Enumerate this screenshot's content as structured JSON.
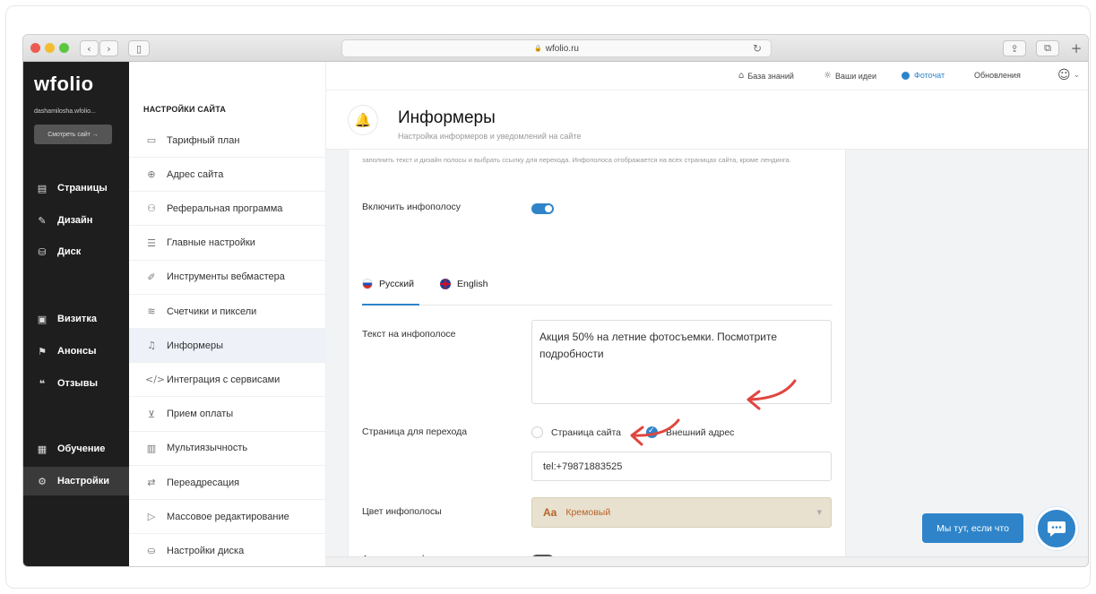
{
  "browser": {
    "url": "wfolio.ru",
    "back_glyph": "‹",
    "forward_glyph": "›",
    "sidebar_glyph": "▯",
    "share_glyph": "⇪",
    "tabs_glyph": "⧉",
    "newtab_glyph": "+",
    "reload_glyph": "↻",
    "lock_glyph": "🔒"
  },
  "leftnav": {
    "logo": "wfolio",
    "user": "dashamilosha.wfolio...",
    "view_site": "Смотреть сайт →",
    "items": [
      {
        "label": "Страницы",
        "icon": "page-icon",
        "glyph": "▤"
      },
      {
        "label": "Дизайн",
        "icon": "brush-icon",
        "glyph": "✎"
      },
      {
        "label": "Диск",
        "icon": "disk-icon",
        "glyph": "⛁"
      },
      {
        "label": "Визитка",
        "icon": "card-icon",
        "glyph": "▣"
      },
      {
        "label": "Анонсы",
        "icon": "megaphone-icon",
        "glyph": "⚑"
      },
      {
        "label": "Отзывы",
        "icon": "comments-icon",
        "glyph": "❝"
      },
      {
        "label": "Обучение",
        "icon": "book-icon",
        "glyph": "▦"
      },
      {
        "label": "Настройки",
        "icon": "gear-icon",
        "glyph": "⚙"
      }
    ]
  },
  "settings": {
    "title": "НАСТРОЙКИ САЙТА",
    "items": [
      {
        "label": "Тарифный план",
        "icon": "tariff-icon",
        "glyph": "▭"
      },
      {
        "label": "Адрес сайта",
        "icon": "globe-icon",
        "glyph": "⊕"
      },
      {
        "label": "Реферальная программа",
        "icon": "referral-icon",
        "glyph": "⚇"
      },
      {
        "label": "Главные настройки",
        "icon": "sliders-icon",
        "glyph": "☰"
      },
      {
        "label": "Инструменты вебмастера",
        "icon": "wrench-icon",
        "glyph": "✐"
      },
      {
        "label": "Счетчики и пиксели",
        "icon": "chart-icon",
        "glyph": "≋"
      },
      {
        "label": "Информеры",
        "icon": "bell-icon",
        "glyph": "♫"
      },
      {
        "label": "Интеграция с сервисами",
        "icon": "code-icon",
        "glyph": "</>"
      },
      {
        "label": "Прием оплаты",
        "icon": "cart-icon",
        "glyph": "⊻"
      },
      {
        "label": "Мультиязычность",
        "icon": "language-icon",
        "glyph": "▥"
      },
      {
        "label": "Переадресация",
        "icon": "redirect-icon",
        "glyph": "⇄"
      },
      {
        "label": "Массовое редактирование",
        "icon": "bulk-edit-icon",
        "glyph": "▷"
      },
      {
        "label": "Настройки диска",
        "icon": "disk-settings-icon",
        "glyph": "⛀"
      }
    ]
  },
  "topbar": {
    "knowledge": "База знаний",
    "ideas": "Ваши идеи",
    "photochat": "Фоточат",
    "updates": "Обновления",
    "knowledge_glyph": "⌂",
    "ideas_glyph": "☼",
    "account_glyph": "☺",
    "account_caret": "⌄"
  },
  "page": {
    "title": "Информеры",
    "subtitle": "Настройка информеров и уведомлений на сайте",
    "bell_glyph": "🔔"
  },
  "form": {
    "description": "заполнить текст и дизайн полосы и выбрать ссылку для перехода. Инфополоса отображается на всех страницах сайта, кроме лендинга.",
    "enable_label": "Включить инфополосу",
    "enable_on": true,
    "tabs": [
      {
        "label": "Русский",
        "icon": "russia-flag-icon",
        "active": true
      },
      {
        "label": "English",
        "icon": "uk-flag-icon",
        "active": false
      }
    ],
    "text_label": "Текст на инфополосе",
    "text_value": "Акция 50% на летние фотосъемки. Посмотрите подробности",
    "link_label": "Страница для перехода",
    "options": [
      {
        "label": "Страница сайта",
        "checked": false
      },
      {
        "label": "Внешний адрес",
        "checked": true
      }
    ],
    "link_value": "tel:+79871883525",
    "color_label": "Цвет инфополосы",
    "color_aa": "Aa",
    "color_value": "Кремовый",
    "animation_label": "Анимация инфополосы",
    "animation_on": false
  },
  "chat": {
    "button": "Мы тут, если что"
  },
  "colors": {
    "accent": "#2f84c9",
    "annotation_arrow": "#e0463f",
    "cream": "#e9e1cf"
  }
}
